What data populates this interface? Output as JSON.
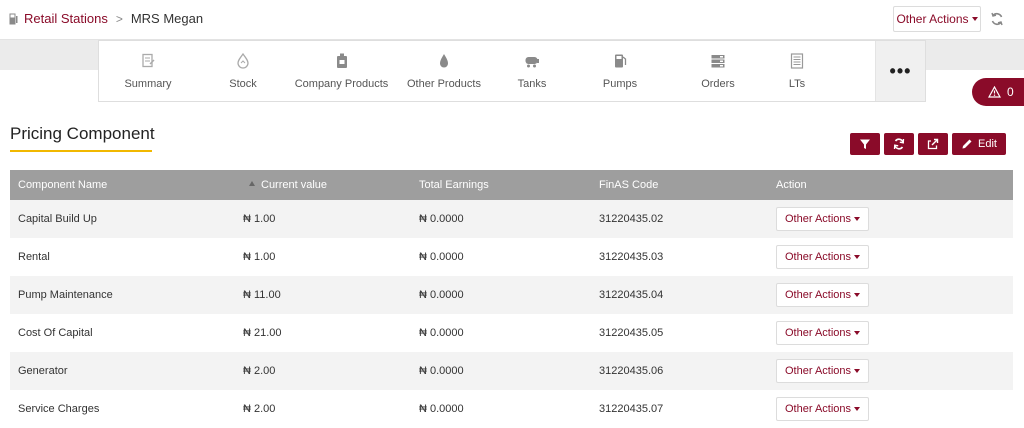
{
  "breadcrumb": {
    "root": "Retail Stations",
    "current": "MRS Megan"
  },
  "header": {
    "other_actions": "Other Actions"
  },
  "tabs": [
    {
      "label": "Summary",
      "icon": "summary-icon"
    },
    {
      "label": "Stock",
      "icon": "stock-icon"
    },
    {
      "label": "Company Products",
      "icon": "company-products-icon"
    },
    {
      "label": "Other Products",
      "icon": "other-products-icon"
    },
    {
      "label": "Tanks",
      "icon": "tanks-icon"
    },
    {
      "label": "Pumps",
      "icon": "pumps-icon"
    },
    {
      "label": "Orders",
      "icon": "orders-icon"
    },
    {
      "label": "LTs",
      "icon": "lts-icon"
    },
    {
      "label": "•••",
      "icon": "more-icon"
    }
  ],
  "alert": {
    "count": "0"
  },
  "section": {
    "title": "Pricing Component",
    "edit_label": "Edit"
  },
  "table": {
    "columns": [
      "Component Name",
      "Current value",
      "Total Earnings",
      "FinAS Code",
      "Action"
    ],
    "rows": [
      {
        "name": "Capital Build Up",
        "value": "₦ 1.00",
        "earnings": "₦ 0.0000",
        "code": "31220435.02",
        "action": "Other Actions"
      },
      {
        "name": "Rental",
        "value": "₦ 1.00",
        "earnings": "₦ 0.0000",
        "code": "31220435.03",
        "action": "Other Actions"
      },
      {
        "name": "Pump Maintenance",
        "value": "₦ 11.00",
        "earnings": "₦ 0.0000",
        "code": "31220435.04",
        "action": "Other Actions"
      },
      {
        "name": "Cost Of Capital",
        "value": "₦ 21.00",
        "earnings": "₦ 0.0000",
        "code": "31220435.05",
        "action": "Other Actions"
      },
      {
        "name": "Generator",
        "value": "₦ 2.00",
        "earnings": "₦ 0.0000",
        "code": "31220435.06",
        "action": "Other Actions"
      },
      {
        "name": "Service Charges",
        "value": "₦ 2.00",
        "earnings": "₦ 0.0000",
        "code": "31220435.07",
        "action": "Other Actions"
      }
    ]
  },
  "colors": {
    "accent": "#8a0b29",
    "underline": "#f1b800",
    "table_header": "#9e9e9e"
  }
}
